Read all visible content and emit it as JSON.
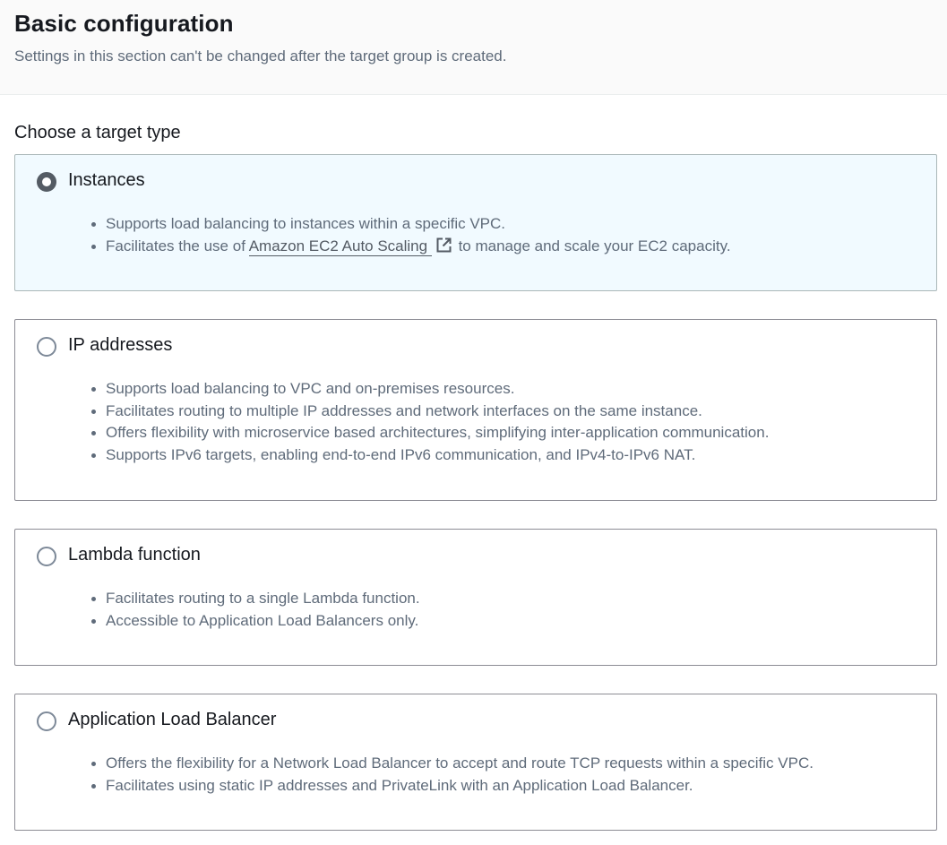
{
  "section": {
    "title": "Basic configuration",
    "description": "Settings in this section can't be changed after the target group is created."
  },
  "target_type": {
    "label": "Choose a target type",
    "selected": "Instances",
    "options": [
      {
        "label": "Instances",
        "selected": true,
        "bullets": [
          "Supports load balancing to instances within a specific VPC."
        ],
        "link_bullet": {
          "prefix": "Facilitates the use of ",
          "link_text": "Amazon EC2 Auto Scaling",
          "link_icon": "external-link-icon",
          "suffix": "to manage and scale your EC2 capacity."
        }
      },
      {
        "label": "IP addresses",
        "selected": false,
        "bullets": [
          "Supports load balancing to VPC and on-premises resources.",
          "Facilitates routing to multiple IP addresses and network interfaces on the same instance.",
          "Offers flexibility with microservice based architectures, simplifying inter-application communication.",
          "Supports IPv6 targets, enabling end-to-end IPv6 communication, and IPv4-to-IPv6 NAT."
        ]
      },
      {
        "label": "Lambda function",
        "selected": false,
        "bullets": [
          "Facilitates routing to a single Lambda function.",
          "Accessible to Application Load Balancers only."
        ]
      },
      {
        "label": "Application Load Balancer",
        "selected": false,
        "bullets": [
          "Offers the flexibility for a Network Load Balancer to accept and route TCP requests within a specific VPC.",
          "Facilitates using static IP addresses and PrivateLink with an Application Load Balancer."
        ]
      }
    ]
  },
  "colors": {
    "selected_tile_bg": "#f1faff",
    "tile_border": "#8c8c94",
    "body_text": "#16191f",
    "secondary_text": "#5f6b7a"
  }
}
